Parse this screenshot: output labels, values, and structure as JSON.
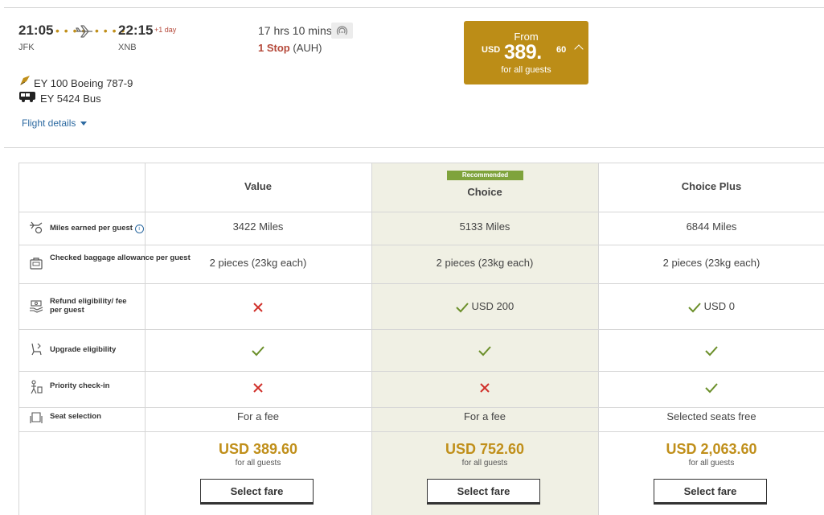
{
  "flight": {
    "depart_time": "21:05",
    "depart_code": "JFK",
    "arrive_time": "22:15",
    "arrive_code": "XNB",
    "plus_day": "+1 day",
    "duration": "17 hrs 10 mins",
    "stop_count": "1 Stop",
    "stop_airport": "(AUH)",
    "segments": [
      {
        "icon": "airline-tail-icon",
        "text": "EY 100 Boeing 787-9"
      },
      {
        "icon": "bus-icon",
        "text": "EY 5424 Bus"
      }
    ],
    "details_link": "Flight details"
  },
  "from_price": {
    "label": "From",
    "currency": "USD",
    "amount": "389.",
    "decimals": "60",
    "note": "for all guests"
  },
  "fares": {
    "columns": [
      {
        "name": "Value",
        "badge": ""
      },
      {
        "name": "Choice",
        "badge": "Recommended"
      },
      {
        "name": "Choice Plus",
        "badge": ""
      }
    ],
    "rows": [
      {
        "label": "Miles earned per guest",
        "icon": "plane-miles-icon",
        "info_icon": "info-icon",
        "cells": [
          {
            "type": "text",
            "text": "3422 Miles"
          },
          {
            "type": "text",
            "text": "5133 Miles"
          },
          {
            "type": "text",
            "text": "6844 Miles"
          }
        ]
      },
      {
        "label": "Checked baggage allowance per guest",
        "icon": "baggage-icon",
        "cells": [
          {
            "type": "text",
            "text": "2 pieces (23kg each)"
          },
          {
            "type": "text",
            "text": "2 pieces (23kg each)"
          },
          {
            "type": "text",
            "text": "2 pieces (23kg each)"
          }
        ]
      },
      {
        "label": "Refund eligibility/ fee per guest",
        "icon": "refund-icon",
        "cells": [
          {
            "type": "cross",
            "text": ""
          },
          {
            "type": "check",
            "text": "USD 200"
          },
          {
            "type": "check",
            "text": "USD 0"
          }
        ]
      },
      {
        "label": "Upgrade eligibility",
        "icon": "seat-upgrade-icon",
        "cells": [
          {
            "type": "check",
            "text": ""
          },
          {
            "type": "check",
            "text": ""
          },
          {
            "type": "check",
            "text": ""
          }
        ]
      },
      {
        "label": "Priority check-in",
        "icon": "priority-checkin-icon",
        "cells": [
          {
            "type": "cross",
            "text": ""
          },
          {
            "type": "cross",
            "text": ""
          },
          {
            "type": "check",
            "text": ""
          }
        ]
      },
      {
        "label": "Seat selection",
        "icon": "seat-icon",
        "cells": [
          {
            "type": "text",
            "text": "For a fee"
          },
          {
            "type": "text",
            "text": "For a fee"
          },
          {
            "type": "text",
            "text": "Selected seats free"
          }
        ]
      }
    ],
    "prices": [
      {
        "amount": "USD 389.60",
        "note": "for all guests",
        "button": "Select fare"
      },
      {
        "amount": "USD 752.60",
        "note": "for all guests",
        "button": "Select fare"
      },
      {
        "amount": "USD 2,063.60",
        "note": "for all guests",
        "button": "Select fare"
      }
    ]
  },
  "colors": {
    "gold": "#bc8d17",
    "check": "#6b8f2a",
    "cross": "#d0302a",
    "stop": "#b5493a",
    "link": "#2d6aa1",
    "recommended": "#7fa33c"
  }
}
